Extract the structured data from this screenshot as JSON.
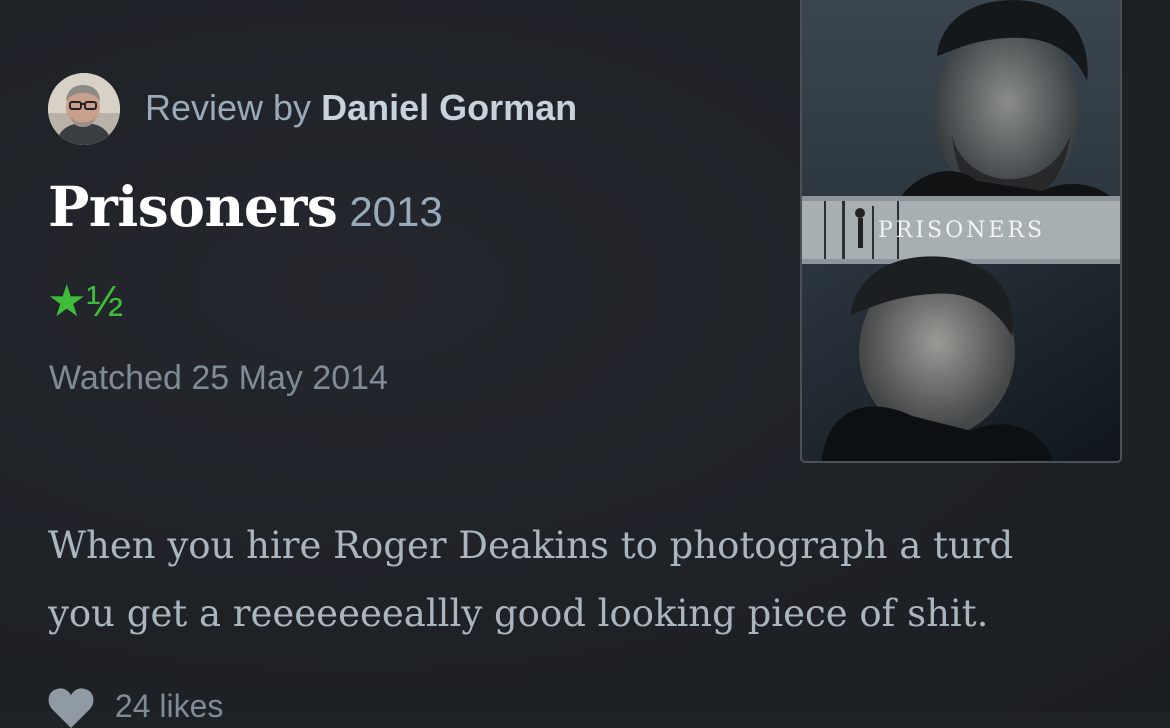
{
  "review": {
    "byline_prefix": "Review by",
    "author": "Daniel Gorman",
    "avatar_icon": "user-avatar-photo"
  },
  "film": {
    "title": "Prisoners",
    "year": "2013",
    "poster_title": "PRISONERS"
  },
  "rating": {
    "display": "★½",
    "stars": 1.5,
    "max_stars": 5,
    "color": "#40bc3b"
  },
  "watched": {
    "text": "Watched 25 May 2014"
  },
  "body": {
    "text": "When you hire Roger Deakins to photograph a turd you get a reeeeeeeallly good looking piece of shit."
  },
  "likes": {
    "icon": "heart-icon",
    "text": "24 likes"
  },
  "colors": {
    "background": "#1f2227",
    "muted_text": "#99aabb",
    "body_text": "#aab5c0"
  }
}
